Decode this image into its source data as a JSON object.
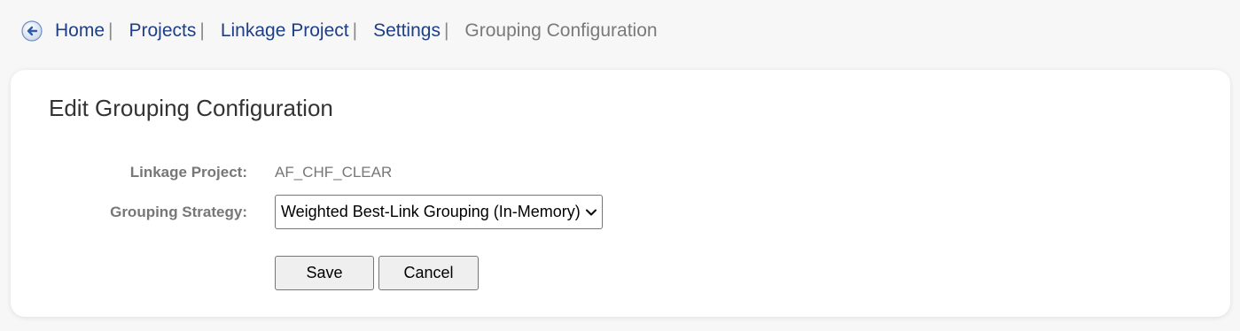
{
  "breadcrumb": {
    "back_icon": "back-arrow-circle-icon",
    "items": [
      {
        "label": "Home"
      },
      {
        "label": "Projects"
      },
      {
        "label": "Linkage Project"
      },
      {
        "label": "Settings"
      }
    ],
    "separator": "|",
    "current": "Grouping Configuration"
  },
  "form": {
    "title": "Edit Grouping Configuration",
    "linkage_project_label": "Linkage Project:",
    "linkage_project_value": "AF_CHF_CLEAR",
    "grouping_strategy_label": "Grouping Strategy:",
    "grouping_strategy_selected": "Weighted Best-Link Grouping (In-Memory)",
    "save_label": "Save",
    "cancel_label": "Cancel"
  },
  "colors": {
    "link": "#1e3f85",
    "muted_text": "#777777",
    "background": "#f7f7f8",
    "card": "#ffffff"
  }
}
